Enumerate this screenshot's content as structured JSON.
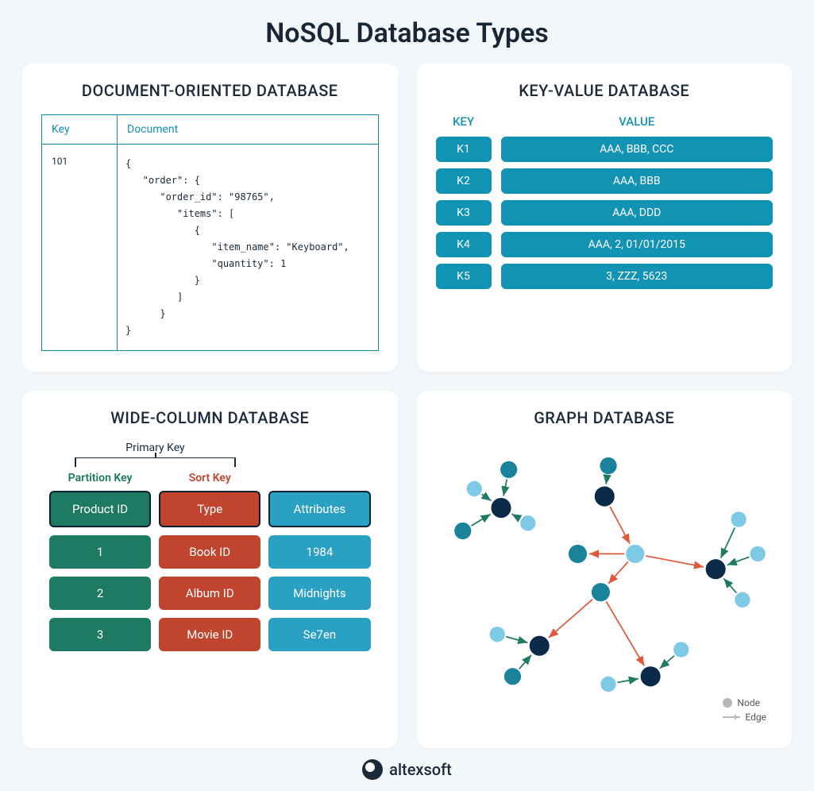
{
  "title": "NoSQL Database Types",
  "doc_card": {
    "title": "DOCUMENT-ORIENTED DATABASE",
    "key_header": "Key",
    "doc_header": "Document",
    "key_value": "101",
    "document_text": "{\n   \"order\": {\n      \"order_id\": \"98765\",\n         \"items\": [\n            {\n               \"item_name\": \"Keyboard\",\n               \"quantity\": 1\n            }\n         ]\n      }\n}"
  },
  "kv_card": {
    "title": "KEY-VALUE DATABASE",
    "key_header": "KEY",
    "value_header": "VALUE",
    "rows": [
      {
        "k": "K1",
        "v": "AAA, BBB, CCC"
      },
      {
        "k": "K2",
        "v": "AAA, BBB"
      },
      {
        "k": "K3",
        "v": "AAA, DDD"
      },
      {
        "k": "K4",
        "v": "AAA, 2, 01/01/2015"
      },
      {
        "k": "K5",
        "v": "3, ZZZ, 5623"
      }
    ]
  },
  "wc_card": {
    "title": "WIDE-COLUMN DATABASE",
    "primary_key_label": "Primary Key",
    "partition_label": "Partition Key",
    "sort_label": "Sort Key",
    "headers": [
      "Product ID",
      "Type",
      "Attributes"
    ],
    "rows": [
      [
        "1",
        "Book ID",
        "1984"
      ],
      [
        "2",
        "Album ID",
        "Midnights"
      ],
      [
        "3",
        "Movie ID",
        "Se7en"
      ]
    ]
  },
  "graph_card": {
    "title": "GRAPH DATABASE",
    "legend_node": "Node",
    "legend_edge": "Edge",
    "colors": {
      "light": "#7ec9e6",
      "mid": "#1b829c",
      "dark": "#0b2a49",
      "edge_green": "#1f7a63",
      "edge_orange": "#e0583b"
    }
  },
  "footer": {
    "brand": "altexsoft"
  }
}
